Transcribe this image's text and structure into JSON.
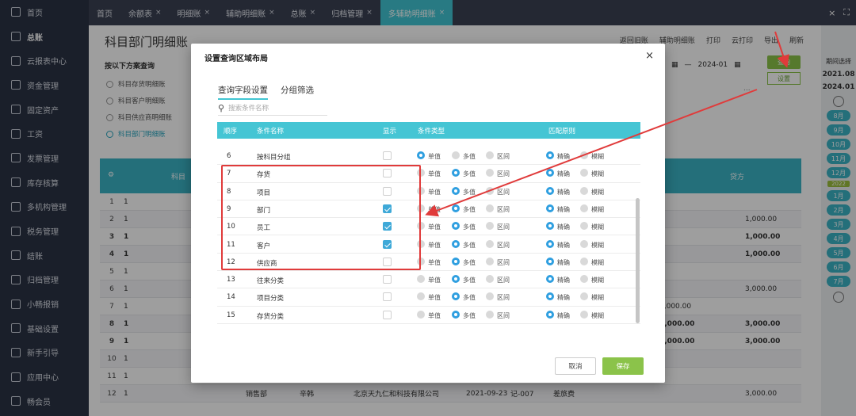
{
  "sidebar": {
    "items": [
      {
        "label": "首页",
        "icon": "home-icon"
      },
      {
        "label": "总账",
        "icon": "ledger-icon"
      },
      {
        "label": "云报表中心",
        "icon": "chart-icon"
      },
      {
        "label": "资金管理",
        "icon": "money-icon"
      },
      {
        "label": "固定资产",
        "icon": "asset-icon"
      },
      {
        "label": "工资",
        "icon": "salary-icon"
      },
      {
        "label": "发票管理",
        "icon": "invoice-icon"
      },
      {
        "label": "库存核算",
        "icon": "warehouse-icon"
      },
      {
        "label": "多机构管理",
        "icon": "org-icon"
      },
      {
        "label": "税务管理",
        "icon": "tax-icon"
      },
      {
        "label": "结账",
        "icon": "close-book-icon"
      },
      {
        "label": "归档管理",
        "icon": "archive-icon"
      },
      {
        "label": "小畅报销",
        "icon": "reimburse-icon"
      },
      {
        "label": "基础设置",
        "icon": "settings-icon"
      },
      {
        "label": "新手引导",
        "icon": "guide-icon"
      },
      {
        "label": "应用中心",
        "icon": "apps-icon"
      },
      {
        "label": "畅会员",
        "icon": "member-icon"
      }
    ]
  },
  "tabs": [
    {
      "label": "首页",
      "close": ""
    },
    {
      "label": "余额表",
      "close": "×"
    },
    {
      "label": "明细账",
      "close": "×"
    },
    {
      "label": "辅助明细账",
      "close": "×"
    },
    {
      "label": "总账",
      "close": "×"
    },
    {
      "label": "归档管理",
      "close": "×"
    },
    {
      "label": "多辅助明细账",
      "close": "×"
    }
  ],
  "window_buttons": {
    "close": "×",
    "fullscreen": "⛶"
  },
  "page": {
    "title": "科目部门明细账",
    "toolbar": [
      "返回旧账",
      "辅助明细账",
      "打印",
      "云打印",
      "导出",
      "刷新"
    ],
    "scheme_label": "按以下方案查询",
    "schemes": [
      "科目存货明细账",
      "科目客户明细账",
      "科目供应商明细账",
      "科目部门明细账"
    ],
    "date_sep": "—",
    "date_end": "2024-01",
    "query_btn": "查询",
    "setting_btn": "设置",
    "dots": "...",
    "table_head": {
      "subject": "科目",
      "credit": "贷方"
    }
  },
  "bg_rows": [
    {
      "no": "1",
      "one": "1",
      "credit": ""
    },
    {
      "no": "2",
      "one": "1",
      "credit": "1,000.00"
    },
    {
      "no": "3",
      "one": "1",
      "credit": "1,000.00"
    },
    {
      "no": "4",
      "one": "1",
      "credit": "1,000.00"
    },
    {
      "no": "5",
      "one": "1",
      "credit": ""
    },
    {
      "no": "6",
      "one": "1",
      "credit": "3,000.00"
    },
    {
      "no": "7",
      "one": "1",
      "debit": "3,000.00",
      "credit": ""
    },
    {
      "no": "8",
      "one": "1",
      "debit": "3,000.00",
      "credit": "3,000.00"
    },
    {
      "no": "9",
      "one": "1",
      "debit": "3,000.00",
      "credit": "3,000.00"
    },
    {
      "no": "10",
      "one": "1",
      "credit": ""
    },
    {
      "no": "11",
      "one": "1",
      "credit": ""
    },
    {
      "no": "12",
      "one": "1",
      "dept": "销售部",
      "person": "辛韩",
      "company": "北京天九仁和科技有限公司",
      "date": "2021-09-23",
      "voucher": "记-007",
      "summary": "差旅费",
      "credit": "3,000.00"
    }
  ],
  "right_panel": {
    "title": "期间选择",
    "from": "2021.08",
    "to": "2024.01",
    "months": [
      "8月",
      "9月",
      "10月",
      "11月",
      "12月",
      "1月",
      "2月",
      "3月",
      "4月",
      "5月",
      "6月",
      "7月"
    ],
    "year_tag": "2022"
  },
  "modal": {
    "title": "设置查询区域布局",
    "close": "×",
    "tabs": [
      "查询字段设置",
      "分组筛选"
    ],
    "search_placeholder": "搜索条件名称",
    "headers": {
      "no": "顺序",
      "name": "条件名称",
      "show": "显示",
      "type": "条件类型",
      "match": "匹配原则"
    },
    "options": {
      "single": "单值",
      "multi": "多值",
      "range": "区间",
      "exact": "精确",
      "fuzzy": "模糊"
    },
    "rows": [
      {
        "no": "6",
        "name": "按科目分组",
        "show": false,
        "type": "single",
        "match": "exact"
      },
      {
        "no": "7",
        "name": "存货",
        "show": false,
        "type": "multi",
        "match": "exact"
      },
      {
        "no": "8",
        "name": "项目",
        "show": false,
        "type": "multi",
        "match": "exact"
      },
      {
        "no": "9",
        "name": "部门",
        "show": true,
        "type": "multi",
        "match": "exact"
      },
      {
        "no": "10",
        "name": "员工",
        "show": true,
        "type": "multi",
        "match": "exact"
      },
      {
        "no": "11",
        "name": "客户",
        "show": true,
        "type": "multi",
        "match": "exact"
      },
      {
        "no": "12",
        "name": "供应商",
        "show": false,
        "type": "multi",
        "match": "exact"
      },
      {
        "no": "13",
        "name": "往来分类",
        "show": false,
        "type": "multi",
        "match": "exact"
      },
      {
        "no": "14",
        "name": "项目分类",
        "show": false,
        "type": "multi",
        "match": "exact"
      },
      {
        "no": "15",
        "name": "存货分类",
        "show": false,
        "type": "multi",
        "match": "exact"
      }
    ],
    "cancel": "取消",
    "save": "保存"
  },
  "colors": {
    "accent": "#42c6d3",
    "sidebar": "#2b3244",
    "save": "#8bc34a",
    "annotation": "#e03b3b"
  }
}
